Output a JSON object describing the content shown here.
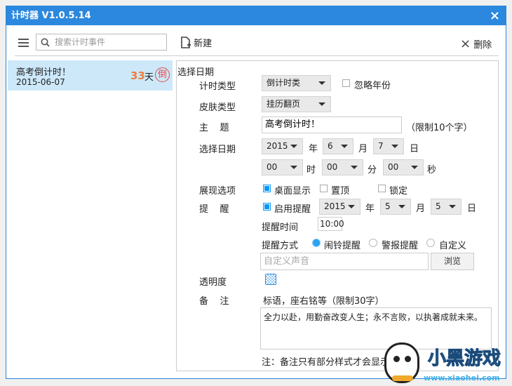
{
  "window": {
    "title": "计时器 V1.0.5.14",
    "close": "×"
  },
  "toolbar": {
    "search_placeholder": "搜索计时事件",
    "new_label": "新建",
    "delete_label": "删除",
    "delete_icon": "×"
  },
  "list": [
    {
      "title": "高考倒计时！",
      "date": "2015-06-07",
      "days": "33",
      "days_unit": "天",
      "badge": "倒"
    }
  ],
  "form": {
    "section": "选择日期",
    "timer_type_label": "计时类型",
    "timer_type": "倒计时类",
    "ignore_year": "忽略年份",
    "skin_label": "皮肤类型",
    "skin": "挂历翻页",
    "subject_label": "主    题",
    "subject": "高考倒计时！",
    "subject_hint": "（限制10个字）",
    "date_label": "选择日期",
    "year": "2015",
    "year_unit": "年",
    "month": "6",
    "month_unit": "月",
    "day": "7",
    "day_unit": "日",
    "hour": "00",
    "hour_unit": "时",
    "minute": "00",
    "minute_unit": "分",
    "second": "00",
    "second_unit": "秒",
    "display_label": "展现选项",
    "desktop": "桌面显示",
    "on_top": "置顶",
    "lock": "锁定",
    "remind_label": "提    醒",
    "enable_remind": "启用提醒",
    "r_year": "2015",
    "r_month": "5",
    "r_day": "5",
    "remind_time_label": "提醒时间",
    "remind_time": "10:00",
    "remind_mode_label": "提醒方式",
    "mode_alarm": "闹铃提醒",
    "mode_siren": "警报提醒",
    "mode_custom": "自定义",
    "custom_sound_placeholder": "自定义声音",
    "browse": "浏览",
    "opacity_label": "透明度",
    "note_label": "备    注",
    "note_hint": "标语，座右铭等（限制30字）",
    "note": "全力以赴，用勤奋改变人生；永不言败，以执著成就未来。",
    "footnote": "注：备注只有部分样式才会显示"
  },
  "watermark": {
    "brand": "小黑游戏",
    "url": "www.xiaohei.com"
  }
}
